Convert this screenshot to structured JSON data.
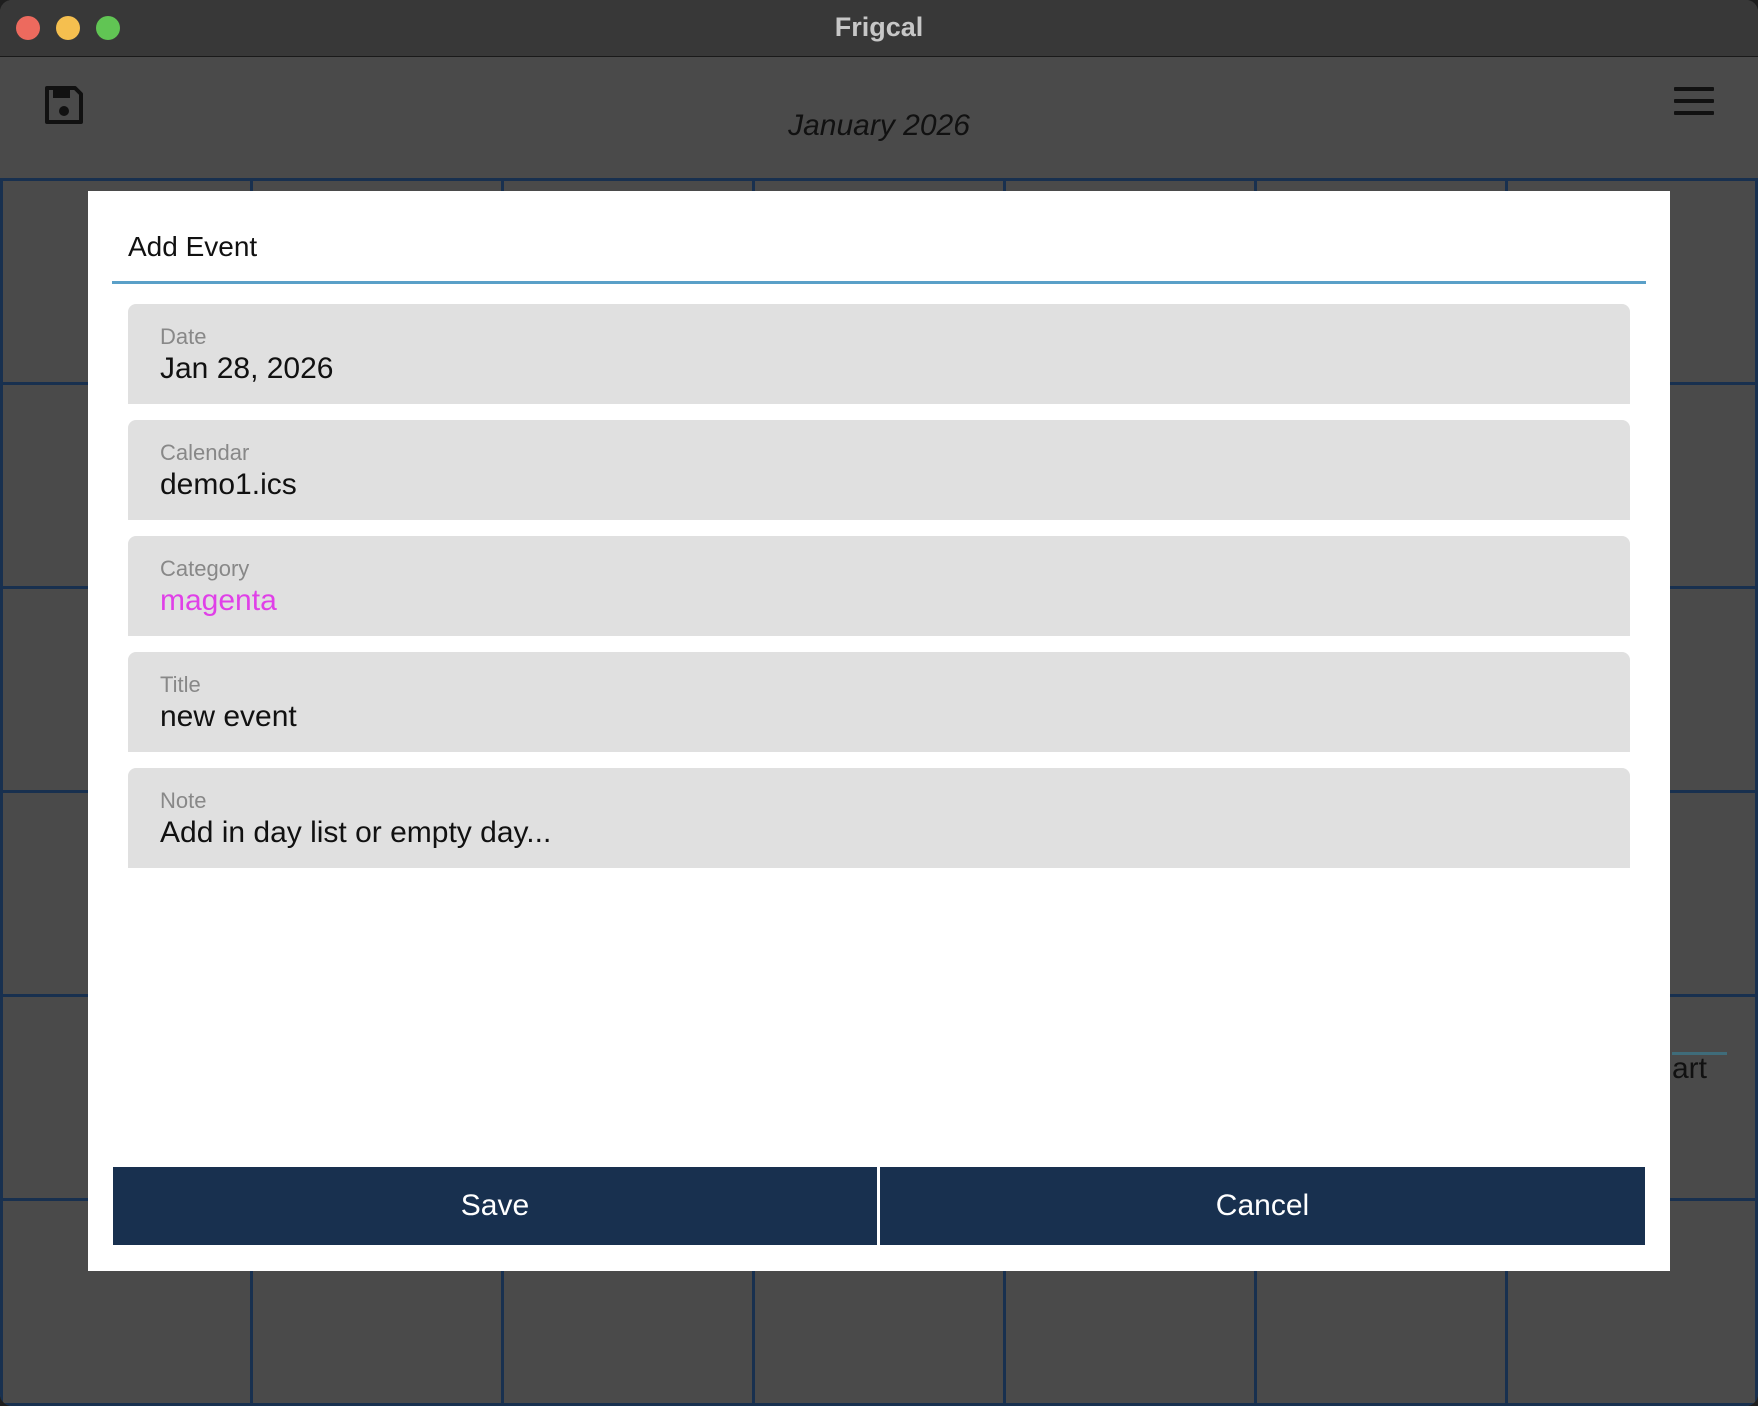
{
  "window": {
    "title": "Frigcal"
  },
  "toolbar": {
    "month_title": "January 2026"
  },
  "background": {
    "partial_text": "art"
  },
  "dialog": {
    "title": "Add Event",
    "fields": [
      {
        "label": "Date",
        "value": "Jan 28, 2026"
      },
      {
        "label": "Calendar",
        "value": "demo1.ics"
      },
      {
        "label": "Category",
        "value": "magenta"
      },
      {
        "label": "Title",
        "value": "new event"
      },
      {
        "label": "Note",
        "value": "Add in day list or empty day..."
      }
    ],
    "save_label": "Save",
    "cancel_label": "Cancel"
  },
  "colors": {
    "calendar_bg": "#4a4a4a",
    "grid_line": "#18304f",
    "button_bg": "#18304f",
    "accent_underline": "#5aa0c8",
    "category_magenta": "#e040e8"
  }
}
